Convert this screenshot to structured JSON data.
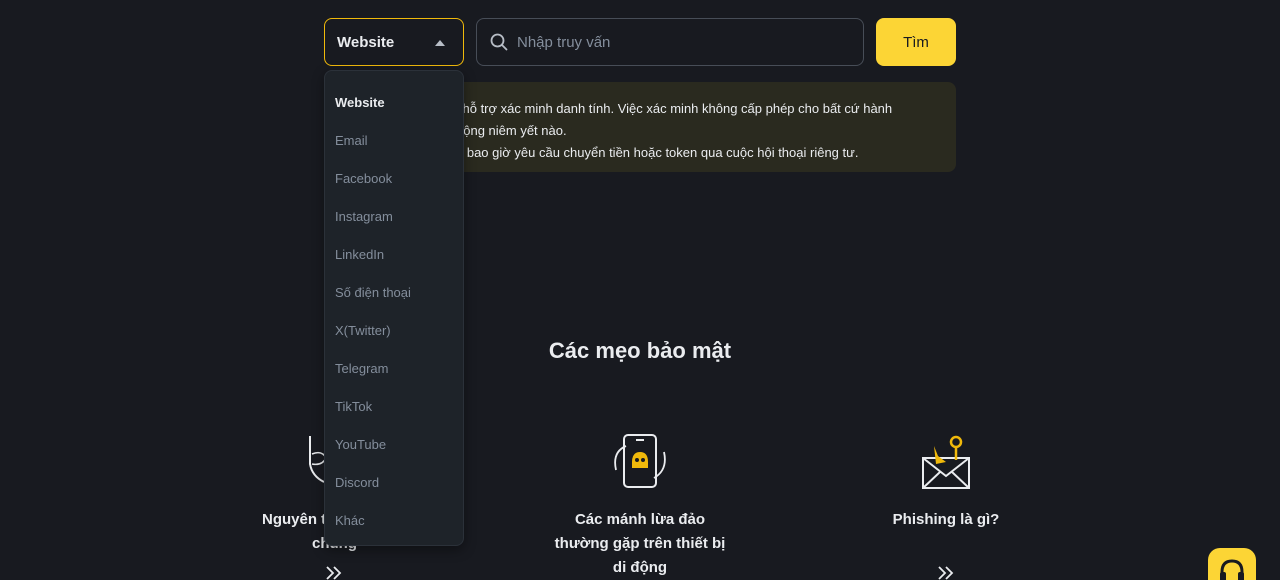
{
  "search_bar": {
    "select_value": "Website",
    "input_placeholder": "Nhập truy vấn",
    "input_value": "",
    "button_label": "Tìm"
  },
  "dropdown": {
    "options": [
      "Website",
      "Email",
      "Facebook",
      "Instagram",
      "LinkedIn",
      "Số điện thoại",
      "X(Twitter)",
      "Telegram",
      "TikTok",
      "YouTube",
      "Discord",
      "Khác"
    ],
    "selected": "Website"
  },
  "notice": {
    "line1": "i hỗ trợ xác minh danh tính. Việc xác minh không cấp phép cho bất cứ hành",
    "line2": "động niêm yết nào.",
    "line3": "g bao giờ yêu cầu chuyển tiền hoặc token qua cuộc hội thoại riêng tư."
  },
  "tips": {
    "title": "Các mẹo bảo mật",
    "cards": [
      {
        "title_line1": "Nguyên t",
        "title_line2": "chung",
        "icon": "shield-icon"
      },
      {
        "title_line1": "Các mánh lừa đảo",
        "title_line2": "thường gặp trên thiết bị",
        "title_line3": "di động",
        "icon": "phone-scam-icon"
      },
      {
        "title_line1": "Phishing là gì?",
        "icon": "phishing-envelope-icon"
      }
    ]
  },
  "colors": {
    "accent": "#fcd535",
    "border_focus": "#f0b90b",
    "background": "#181a20",
    "notice_bg": "#2a2a1f",
    "dropdown_bg": "#1e2329"
  }
}
